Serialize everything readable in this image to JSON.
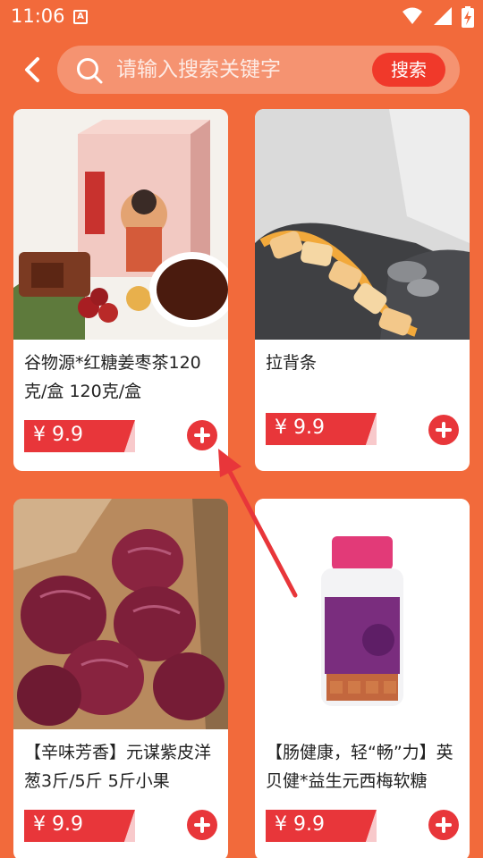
{
  "status_bar": {
    "time": "11:06",
    "notification_icon": "A"
  },
  "header": {
    "back_icon": "chevron-left-icon",
    "search_placeholder": "请输入搜索关键字",
    "search_button": "搜索"
  },
  "products": [
    {
      "title": "谷物源*红糖姜枣茶120克/盒 120克/盒",
      "price": "¥ 9.9",
      "image": "brown-sugar-ginger-tea-box"
    },
    {
      "title": "拉背条",
      "price": "¥ 9.9",
      "image": "massage-roller-strap"
    },
    {
      "title": "【辛味芳香】元谋紫皮洋葱3斤/5斤 5斤小果",
      "price": "¥ 9.9",
      "image": "red-onions-in-box"
    },
    {
      "title": "【肠健康，轻“畅”力】英贝健*益生元西梅软糖",
      "price": "¥ 9.9",
      "image": "probiotic-prune-gummy-bottle"
    }
  ],
  "colors": {
    "background": "#F26A3B",
    "accent_red": "#E8363A",
    "search_button": "#F0392A"
  }
}
